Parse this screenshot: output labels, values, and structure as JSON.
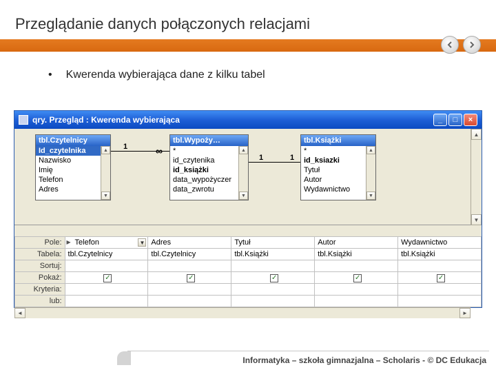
{
  "slide": {
    "title": "Przeglądanie danych połączonych relacjami",
    "bullet": "Kwerenda wybierająca dane z kilku tabel",
    "footer": "Informatyka – szkoła gimnazjalna – Scholaris - © DC Edukacja"
  },
  "window": {
    "title": "qry. Przegląd : Kwerenda wybierająca"
  },
  "tables": {
    "t1": {
      "name": "tbl.Czytelnicy",
      "fields": [
        "Id_czytelnika",
        "Nazwisko",
        "Imię",
        "Telefon",
        "Adres"
      ],
      "pk": 0
    },
    "t2": {
      "name": "tbl.Wypoży…",
      "fields": [
        "*",
        "id_czytenika",
        "id_książki",
        "data_wypożyczer",
        "data_zwrotu"
      ],
      "pk": -1
    },
    "t3": {
      "name": "tbl.Książki",
      "fields": [
        "*",
        "id_ksiazki",
        "Tytuł",
        "Autor",
        "Wydawnictwo"
      ],
      "pk": 1
    }
  },
  "relations": {
    "left1": "1",
    "inf": "∞",
    "one1": "1",
    "one2": "1"
  },
  "grid": {
    "labels": {
      "pole": "Pole:",
      "tabela": "Tabela:",
      "sortuj": "Sortuj:",
      "pokaz": "Pokaż:",
      "kryteria": "Kryteria:",
      "lub": "lub:"
    },
    "cols": [
      {
        "pole": "Telefon",
        "tabela": "tbl.Czytelnicy"
      },
      {
        "pole": "Adres",
        "tabela": "tbl.Czytelnicy"
      },
      {
        "pole": "Tytuł",
        "tabela": "tbl.Książki"
      },
      {
        "pole": "Autor",
        "tabela": "tbl.Książki"
      },
      {
        "pole": "Wydawnictwo",
        "tabela": "tbl.Książki"
      }
    ],
    "check": "✓"
  }
}
